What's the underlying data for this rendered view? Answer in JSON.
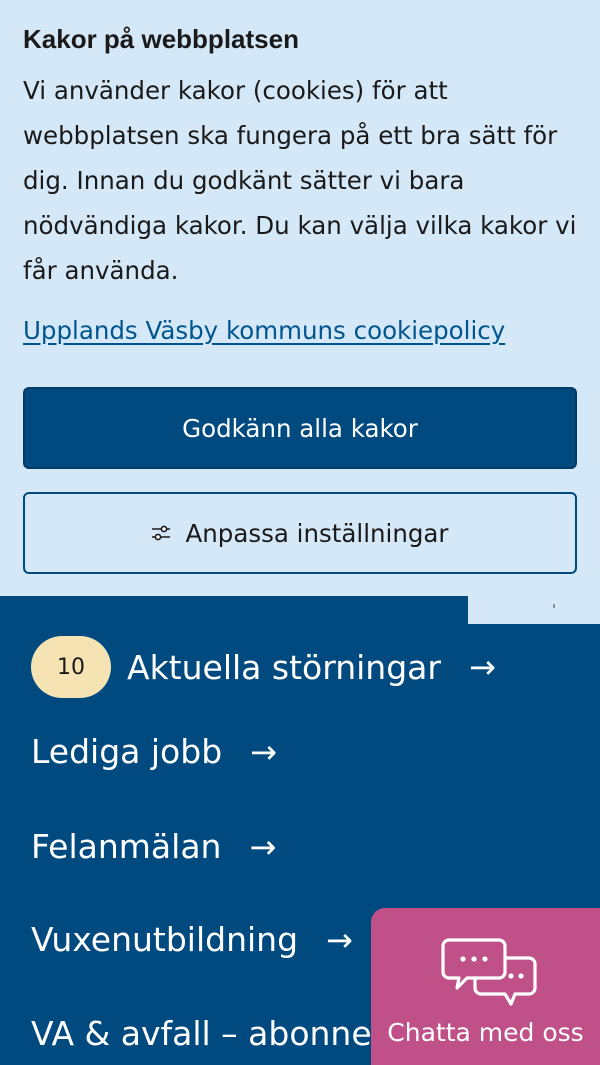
{
  "cookie": {
    "title": "Kakor på webbplatsen",
    "text": "Vi använder kakor (cookies) för att webbplatsen ska fungera på ett bra sätt för dig. Innan du godkänt sätter vi bara nödvändiga kakor. Du kan välja vilka kakor vi får använda.",
    "policy_link": "Upplands Väsby kommuns cookiepolicy",
    "accept_label": "Godkänn alla kakor",
    "customize_label": "Anpassa inställningar",
    "customize_icon": "sliders-icon"
  },
  "quick_links": {
    "items": [
      {
        "badge": "10",
        "label": "Aktuella störningar",
        "arrow": "→"
      },
      {
        "label": "Lediga jobb",
        "arrow": "→"
      },
      {
        "label": "Felanmälan",
        "arrow": "→"
      },
      {
        "label": "Vuxenutbildning",
        "arrow": "→"
      },
      {
        "label": "VA & avfall – abonnem"
      }
    ]
  },
  "chat": {
    "label": "Chatta med oss",
    "icon": "chat-bubbles-icon"
  },
  "colors": {
    "banner_bg": "#d4e8f8",
    "primary": "#004a80",
    "badge": "#f6e3b4",
    "chat": "#c05088"
  }
}
